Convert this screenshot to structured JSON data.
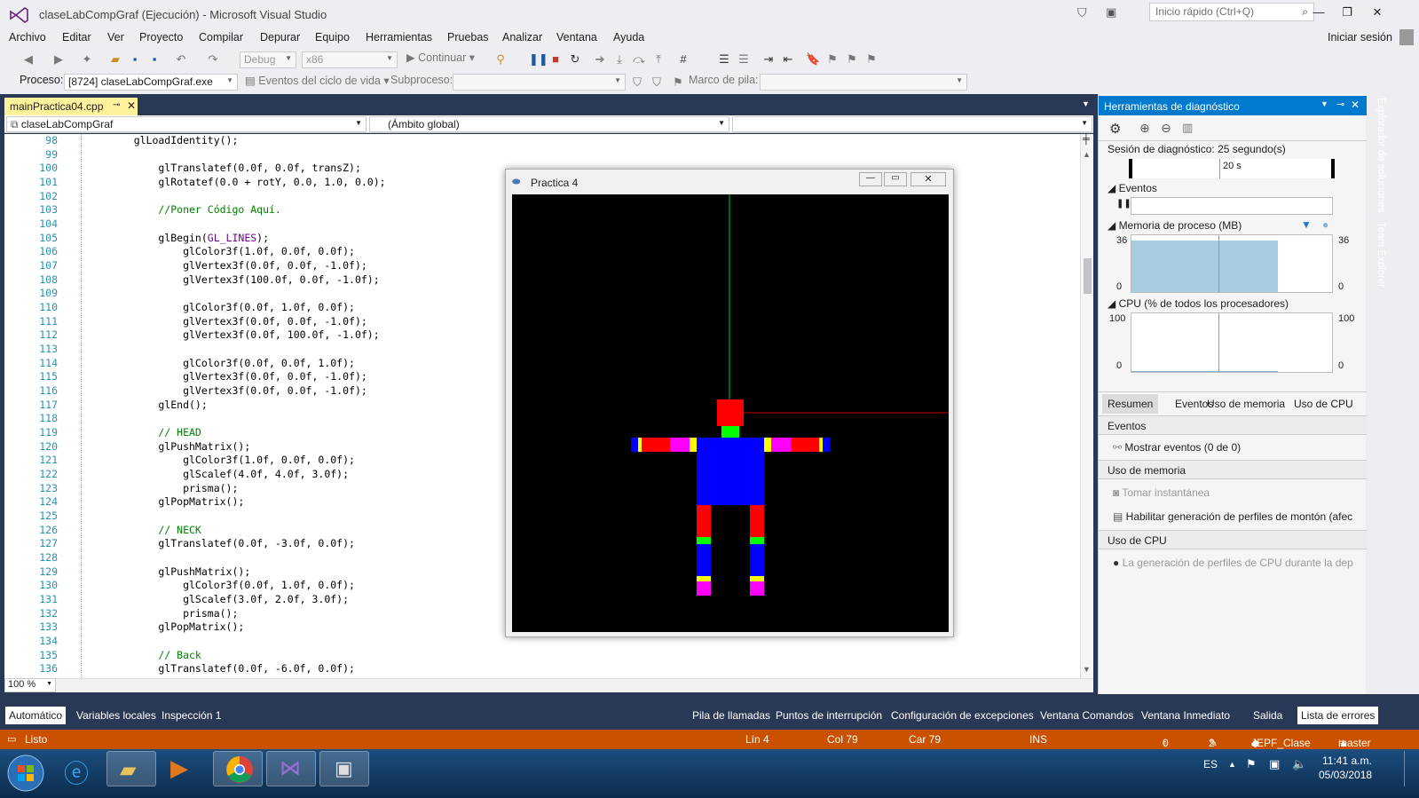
{
  "window": {
    "title": "claseLabCompGraf (Ejecución) - Microsoft Visual Studio"
  },
  "quick_launch": {
    "placeholder": "Inicio rápido (Ctrl+Q)"
  },
  "sign_in": "Iniciar sesión",
  "menu": [
    "Archivo",
    "Editar",
    "Ver",
    "Proyecto",
    "Compilar",
    "Depurar",
    "Equipo",
    "Herramientas",
    "Pruebas",
    "Analizar",
    "Ventana",
    "Ayuda"
  ],
  "toolbar": {
    "config": "Debug",
    "platform": "x86",
    "continue_label": "Continuar"
  },
  "debug_location": {
    "process_label": "Proceso:",
    "process_value": "[8724] claseLabCompGraf.exe",
    "lifecycle_label": "Eventos del ciclo de vida",
    "thread_label": "Subproceso:",
    "stack_label": "Marco de pila:"
  },
  "editor": {
    "tab": "mainPractica04.cpp",
    "project_dropdown": "claseLabCompGraf",
    "scope_dropdown": "(Ámbito global)",
    "zoom": "100 %",
    "lines": [
      {
        "n": "98",
        "code": "    glLoadIdentity();",
        "cls": ""
      },
      {
        "n": "99",
        "code": "",
        "cls": ""
      },
      {
        "n": "100",
        "code": "        glTranslatef(0.0f, 0.0f, transZ);",
        "cls": ""
      },
      {
        "n": "101",
        "code": "        glRotatef(0.0 + rotY, 0.0, 1.0, 0.0);",
        "cls": ""
      },
      {
        "n": "102",
        "code": "",
        "cls": ""
      },
      {
        "n": "103",
        "code": "        //Poner Código Aquí.",
        "cls": "cmt"
      },
      {
        "n": "104",
        "code": "",
        "cls": ""
      },
      {
        "n": "105",
        "code": "        glBegin(GL_LINES);",
        "cls": ""
      },
      {
        "n": "106",
        "code": "            glColor3f(1.0f, 0.0f, 0.0f);",
        "cls": ""
      },
      {
        "n": "107",
        "code": "            glVertex3f(0.0f, 0.0f, -1.0f);",
        "cls": ""
      },
      {
        "n": "108",
        "code": "            glVertex3f(100.0f, 0.0f, -1.0f);",
        "cls": ""
      },
      {
        "n": "109",
        "code": "",
        "cls": ""
      },
      {
        "n": "110",
        "code": "            glColor3f(0.0f, 1.0f, 0.0f);",
        "cls": ""
      },
      {
        "n": "111",
        "code": "            glVertex3f(0.0f, 0.0f, -1.0f);",
        "cls": ""
      },
      {
        "n": "112",
        "code": "            glVertex3f(0.0f, 100.0f, -1.0f);",
        "cls": ""
      },
      {
        "n": "113",
        "code": "",
        "cls": ""
      },
      {
        "n": "114",
        "code": "            glColor3f(0.0f, 0.0f, 1.0f);",
        "cls": ""
      },
      {
        "n": "115",
        "code": "            glVertex3f(0.0f, 0.0f, -1.0f);",
        "cls": ""
      },
      {
        "n": "116",
        "code": "            glVertex3f(0.0f, 0.0f, -1.0f);",
        "cls": ""
      },
      {
        "n": "117",
        "code": "        glEnd();",
        "cls": ""
      },
      {
        "n": "118",
        "code": "",
        "cls": ""
      },
      {
        "n": "119",
        "code": "        // HEAD",
        "cls": "cmt"
      },
      {
        "n": "120",
        "code": "        glPushMatrix();",
        "cls": ""
      },
      {
        "n": "121",
        "code": "            glColor3f(1.0f, 0.0f, 0.0f);",
        "cls": ""
      },
      {
        "n": "122",
        "code": "            glScalef(4.0f, 4.0f, 3.0f);",
        "cls": ""
      },
      {
        "n": "123",
        "code": "            prisma();",
        "cls": ""
      },
      {
        "n": "124",
        "code": "        glPopMatrix();",
        "cls": ""
      },
      {
        "n": "125",
        "code": "",
        "cls": ""
      },
      {
        "n": "126",
        "code": "        // NECK",
        "cls": "cmt"
      },
      {
        "n": "127",
        "code": "        glTranslatef(0.0f, -3.0f, 0.0f);",
        "cls": ""
      },
      {
        "n": "128",
        "code": "",
        "cls": ""
      },
      {
        "n": "129",
        "code": "        glPushMatrix();",
        "cls": ""
      },
      {
        "n": "130",
        "code": "            glColor3f(0.0f, 1.0f, 0.0f);",
        "cls": ""
      },
      {
        "n": "131",
        "code": "            glScalef(3.0f, 2.0f, 3.0f);",
        "cls": ""
      },
      {
        "n": "132",
        "code": "            prisma();",
        "cls": ""
      },
      {
        "n": "133",
        "code": "        glPopMatrix();",
        "cls": ""
      },
      {
        "n": "134",
        "code": "",
        "cls": ""
      },
      {
        "n": "135",
        "code": "        // Back",
        "cls": "cmt"
      },
      {
        "n": "136",
        "code": "        glTranslatef(0.0f, -6.0f, 0.0f);",
        "cls": ""
      }
    ]
  },
  "gl_window": {
    "title": "Practica 4"
  },
  "diagnostics": {
    "title": "Herramientas de diagnóstico",
    "session": "Sesión de diagnóstico: 25 segundo(s)",
    "timeline_label": "20 s",
    "events_header": "Eventos",
    "memory_header": "Memoria de proceso (MB)",
    "memory_max": "36",
    "memory_min": "0",
    "cpu_header": "CPU (% de todos los procesadores)",
    "cpu_max": "100",
    "cpu_min": "0",
    "tabs": [
      "Resumen",
      "Eventos",
      "Uso de memoria",
      "Uso de CPU"
    ],
    "sec_events": "Eventos",
    "show_events": "Mostrar eventos (0 de 0)",
    "sec_memory": "Uso de memoria",
    "snapshot": "Tomar instantánea",
    "heap_profiling": "Habilitar generación de perfiles de montón (afec",
    "sec_cpu": "Uso de CPU",
    "cpu_profiling": "La generación de perfiles de CPU durante la dep"
  },
  "side_tabs": [
    "Explorador de soluciones",
    "Team Explorer"
  ],
  "bottom_tabs_left": [
    "Automático",
    "Variables locales",
    "Inspección 1"
  ],
  "bottom_tabs_right": [
    "Pila de llamadas",
    "Puntos de interrupción",
    "Configuración de excepciones",
    "Ventana Comandos",
    "Ventana Inmediato",
    "Salida",
    "Lista de errores"
  ],
  "status": {
    "ready": "Listo",
    "line": "Lín 4",
    "col": "Col 79",
    "char": "Car 79",
    "ins": "INS",
    "up": "0",
    "edits": "2",
    "repo": "JEPF_Clase",
    "branch": "master"
  },
  "taskbar": {
    "lang": "ES",
    "time": "11:41 a.m.",
    "date": "05/03/2018"
  },
  "colors": {
    "accent": "#007acc",
    "status": "#ca5100",
    "doc_bg": "#293955",
    "tab_active": "#fff29d"
  }
}
